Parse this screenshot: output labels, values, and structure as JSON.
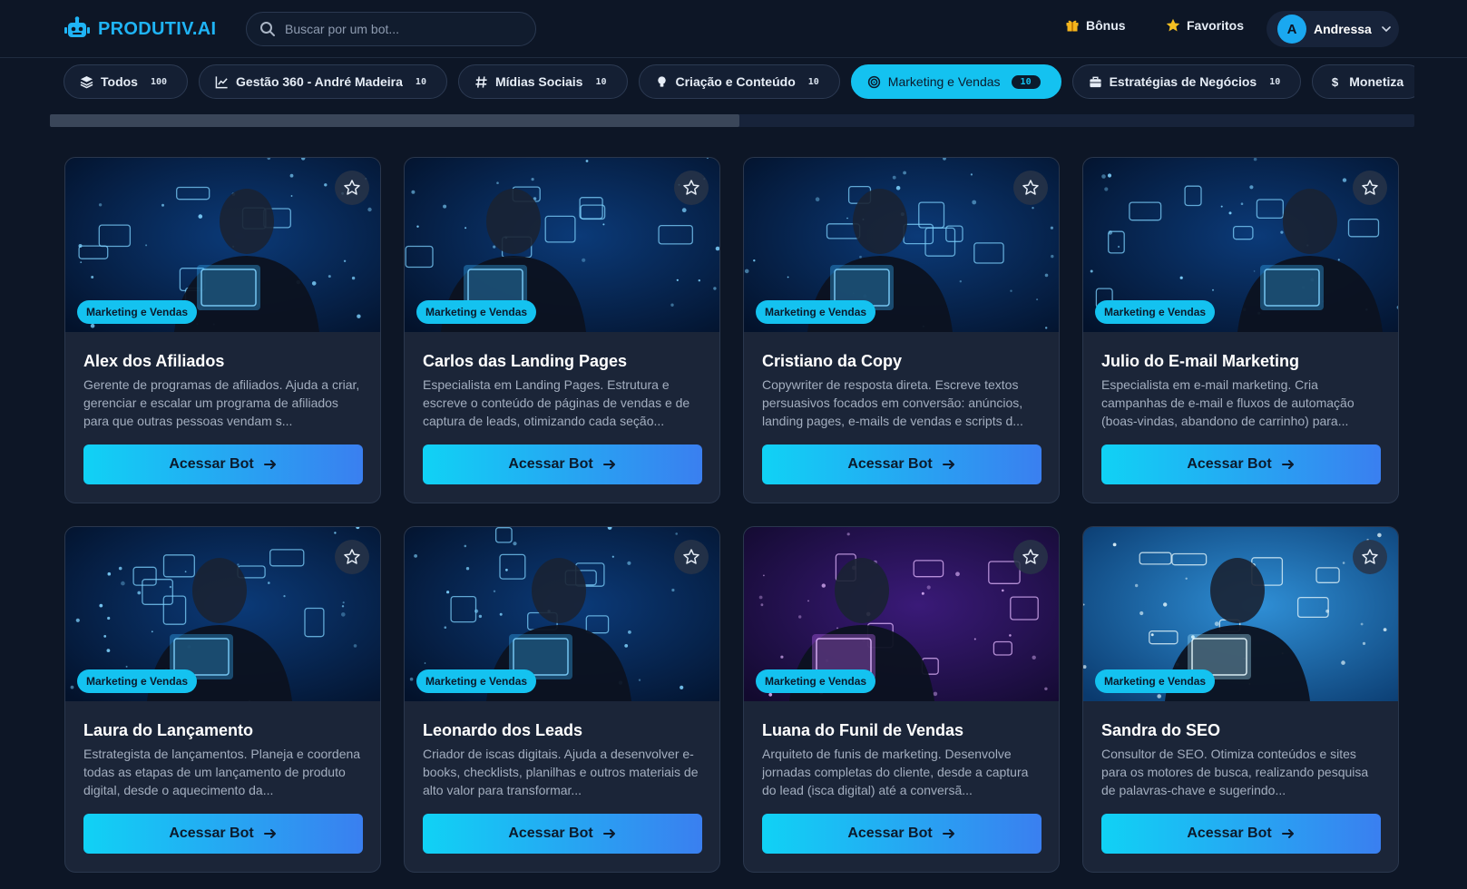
{
  "header": {
    "logo_text": "PRODUTIV.AI",
    "search_placeholder": "Buscar por um bot...",
    "bonus_label": "Bônus",
    "favorites_label": "Favoritos",
    "user": {
      "initial": "A",
      "name": "Andressa"
    }
  },
  "tabs": [
    {
      "label": "Todos",
      "count": "100",
      "icon": "layers-icon",
      "active": false
    },
    {
      "label": "Gestão 360 - André Madeira",
      "count": "10",
      "icon": "chart-line-icon",
      "active": false
    },
    {
      "label": "Mídias Sociais",
      "count": "10",
      "icon": "hashtag-icon",
      "active": false
    },
    {
      "label": "Criação e Conteúdo",
      "count": "10",
      "icon": "lightbulb-icon",
      "active": false
    },
    {
      "label": "Marketing e Vendas",
      "count": "10",
      "icon": "target-icon",
      "active": true
    },
    {
      "label": "Estratégias de Negócios",
      "count": "10",
      "icon": "briefcase-icon",
      "active": false
    },
    {
      "label": "Monetiza",
      "count": "",
      "icon": "dollar-icon",
      "active": false
    }
  ],
  "scroll": {
    "position": 0.5
  },
  "cards": [
    {
      "badge": "Marketing e Vendas",
      "title": "Alex dos Afiliados",
      "description": "Gerente de programas de afiliados. Ajuda a criar, gerenciar e escalar um programa de afiliados para que outras pessoas vendam s...",
      "button": "Acessar Bot",
      "theme": "blue"
    },
    {
      "badge": "Marketing e Vendas",
      "title": "Carlos das Landing Pages",
      "description": "Especialista em Landing Pages. Estrutura e escreve o conteúdo de páginas de vendas e de captura de leads, otimizando cada seção...",
      "button": "Acessar Bot",
      "theme": "blue"
    },
    {
      "badge": "Marketing e Vendas",
      "title": "Cristiano da Copy",
      "description": "Copywriter de resposta direta. Escreve textos persuasivos focados em conversão: anúncios, landing pages, e-mails de vendas e scripts d...",
      "button": "Acessar Bot",
      "theme": "blue"
    },
    {
      "badge": "Marketing e Vendas",
      "title": "Julio do E-mail Marketing",
      "description": "Especialista em e-mail marketing. Cria campanhas de e-mail e fluxos de automação (boas-vindas, abandono de carrinho) para...",
      "button": "Acessar Bot",
      "theme": "blue"
    },
    {
      "badge": "Marketing e Vendas",
      "title": "Laura do Lançamento",
      "description": "Estrategista de lançamentos. Planeja e coordena todas as etapas de um lançamento de produto digital, desde o aquecimento da...",
      "button": "Acessar Bot",
      "theme": "blue"
    },
    {
      "badge": "Marketing e Vendas",
      "title": "Leonardo dos Leads",
      "description": "Criador de iscas digitais. Ajuda a desenvolver e-books, checklists, planilhas e outros materiais de alto valor para transformar...",
      "button": "Acessar Bot",
      "theme": "blue"
    },
    {
      "badge": "Marketing e Vendas",
      "title": "Luana do Funil de Vendas",
      "description": "Arquiteto de funis de marketing. Desenvolve jornadas completas do cliente, desde a captura do lead (isca digital) até a conversã...",
      "button": "Acessar Bot",
      "theme": "purple"
    },
    {
      "badge": "Marketing e Vendas",
      "title": "Sandra do SEO",
      "description": "Consultor de SEO. Otimiza conteúdos e sites para os motores de busca, realizando pesquisa de palavras-chave e sugerindo...",
      "button": "Acessar Bot",
      "theme": "light"
    }
  ]
}
